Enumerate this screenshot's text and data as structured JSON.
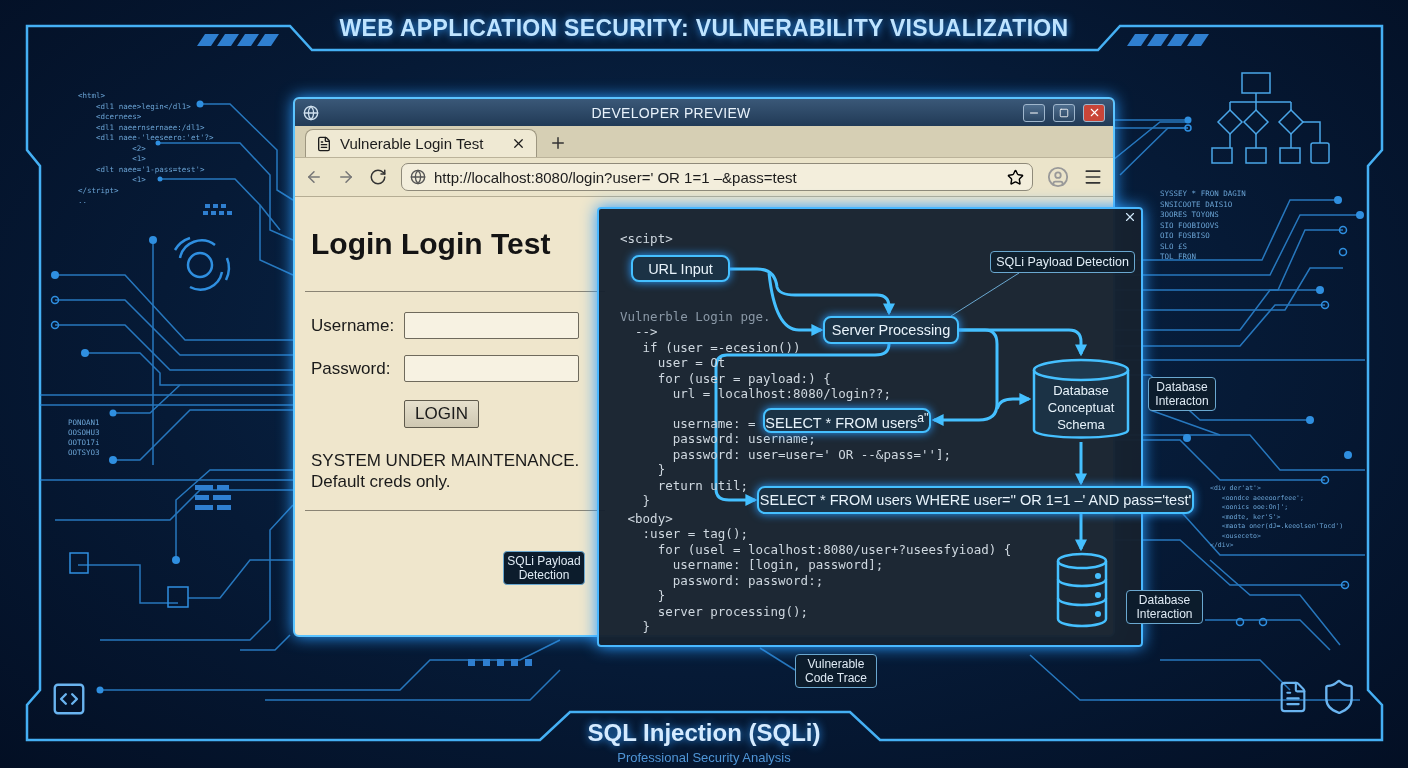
{
  "header": {
    "title": "WEB APPLICATION SECURITY: VULNERABILITY VISUALIZATION"
  },
  "decor": {
    "left_markup": [
      "<html>",
      "    <dl1 naee>legin</dl1>",
      "    <dcernees>",
      "    <dl1 naeernsernaee:/dl1>",
      "    <dl1 naee-'leeseero:'et'?>",
      "            <2>",
      "            <1>",
      "    <dlt naee='1-pass=test'>",
      "            <1>",
      "</stript>",
      ".."
    ],
    "left_hex": [
      "PONOAN1",
      "OOSOHU3",
      "OOTO17i",
      "OOTSYO3"
    ],
    "right_sql": [
      "SYSSEY * FRON DAGIN",
      "SNSICOOTE DAIS1O",
      "3OORES TOYONS",
      "SIO FOOBIOOVS",
      "OIO FOSBISO",
      "SLO £S",
      "TOL FRON"
    ],
    "right_markup": [
      "<div der'at'>",
      "   <oondce aeeeoorfeee';",
      "   <oonics ooe:On]';",
      "   <modte, ker'S'>",
      "   <maota oner(dJ=.keeolsen'Tocd')",
      "   <ouseceto>",
      "</div>"
    ]
  },
  "browser": {
    "title": "DEVELOPER PREVIEW",
    "tabs": [
      {
        "label": "Vulnerable Login Test",
        "selected": true
      }
    ],
    "url": "http://localhost:8080/login?user=' OR 1=1 –&pass=test",
    "page": {
      "heading": "Login Login Test",
      "fields": [
        {
          "label": "Username:"
        },
        {
          "label": "Password:"
        }
      ],
      "button": "LOGIN",
      "notice": [
        "SYSTEM UNDER MAINTENANCE.",
        "Default creds only."
      ]
    }
  },
  "code_panel": {
    "sections": [
      [
        "<scipt>"
      ],
      [
        "Vulnerble Login pge.",
        "  -->",
        "   if (user =-ecesion())",
        "     user = Ot",
        "     for (user = payload:) {",
        "       url = localhost:8080/login??;"
      ],
      [
        "       username: =",
        "       password: username;",
        "       password: user=user=' OR --&pass=''];",
        "     }",
        "     return util;",
        "   }"
      ],
      [
        " <body>",
        "   :user = tag();",
        "     for (usel = localhost:8080/user+?useesfyioad) {",
        "       username: [login, password];",
        "       password: password:;",
        "     }",
        "     server processing();",
        "   }"
      ]
    ],
    "nodes": [
      {
        "kind": "box",
        "text": "URL Input"
      },
      {
        "kind": "tag",
        "text": "SQLi Payload Detection"
      },
      {
        "kind": "box",
        "text": "Server Processing"
      },
      {
        "kind": "box",
        "text": "SELECT * FROM users$^{a''}$"
      },
      {
        "kind": "cylinder",
        "text": "Database Conceptuat Schema"
      },
      {
        "kind": "box",
        "text": "SELECT * FROM users WHERE user='' OR 1=1 –' AND pass='test'"
      },
      {
        "kind": "server"
      }
    ]
  },
  "callouts": [
    {
      "text": "Database Interacton"
    },
    {
      "text": "SQLi Payload Detection"
    },
    {
      "text": "Database Interaction"
    },
    {
      "text": "Vulnerable Code Trace"
    }
  ],
  "footer": {
    "title": "SQL Injection (SQLi)",
    "subtitle": "Professional Security Analysis"
  }
}
